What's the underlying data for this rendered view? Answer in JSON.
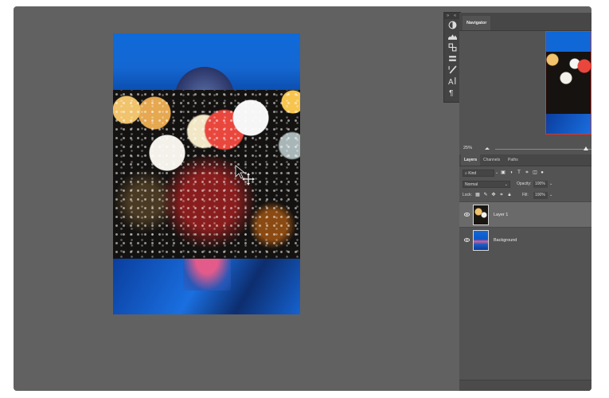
{
  "navigator": {
    "tab_label": "Navigator",
    "zoom": "25%"
  },
  "layers_panel": {
    "tabs": [
      "Layers",
      "Channels",
      "Paths"
    ],
    "filter_kind": "Kind",
    "blend_mode": "Normal",
    "opacity_label": "Opacity:",
    "opacity_value": "100%",
    "lock_label": "Lock:",
    "fill_label": "Fill:",
    "fill_value": "100%",
    "layers": [
      {
        "name": "Layer 1",
        "selected": true
      },
      {
        "name": "Background",
        "selected": false
      }
    ]
  },
  "tools": [
    "adjustments-icon",
    "histogram-icon",
    "channels-icon",
    "swatches-icon",
    "brush-settings-icon",
    "character-icon",
    "paragraph-icon"
  ],
  "colors": {
    "workspace": "#616161",
    "panel": "#535353",
    "panel_header": "#474747",
    "selected_layer": "#6a6a6a",
    "navigator_frame": "#dd3333"
  }
}
